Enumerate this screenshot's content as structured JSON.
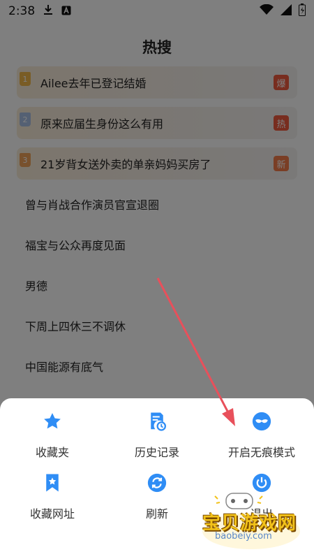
{
  "status_bar": {
    "time": "2:38"
  },
  "page": {
    "title": "热搜"
  },
  "hot_items": [
    {
      "rank": "1",
      "title": "Ailee去年已登记结婚",
      "tag": "爆"
    },
    {
      "rank": "2",
      "title": "原来应届生身份这么有用",
      "tag": "热"
    },
    {
      "rank": "3",
      "title": "21岁背女送外卖的单亲妈妈买房了",
      "tag": "新"
    },
    {
      "title": "曾与肖战合作演员官宣退圈"
    },
    {
      "title": "福宝与公众再度见面"
    },
    {
      "title": "男德"
    },
    {
      "title": "下周上四休三不调休"
    },
    {
      "title": "中国能源有底气"
    }
  ],
  "menu": [
    {
      "label": "收藏夹",
      "icon": "star-icon"
    },
    {
      "label": "历史记录",
      "icon": "history-icon"
    },
    {
      "label": "开启无痕模式",
      "icon": "incognito-mask-icon"
    },
    {
      "label": "收藏网址",
      "icon": "bookmark-icon"
    },
    {
      "label": "刷新",
      "icon": "refresh-icon"
    },
    {
      "label": "退出",
      "icon": "power-icon"
    }
  ],
  "watermark": {
    "title": "宝贝游戏网",
    "url": "baobeiy.com"
  },
  "colors": {
    "accent": "#2f8df5",
    "arrow": "#e8505b",
    "tag_red": "#f05a3f"
  }
}
